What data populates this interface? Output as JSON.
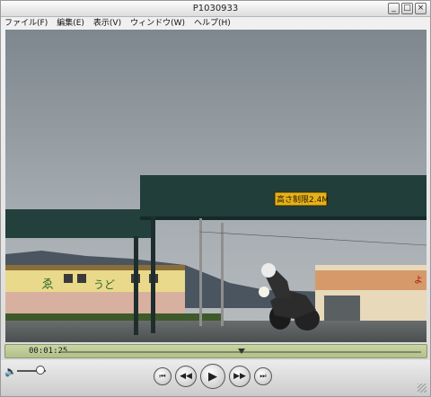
{
  "window": {
    "title": "P1030933",
    "minimize_glyph": "_",
    "maximize_glyph": "□",
    "close_glyph": "×"
  },
  "menu": {
    "items": [
      {
        "label": "ファイル(F)"
      },
      {
        "label": "編集(E)"
      },
      {
        "label": "表示(V)"
      },
      {
        "label": "ウィンドウ(W)"
      },
      {
        "label": "ヘルプ(H)"
      }
    ]
  },
  "video": {
    "sign_text": "高さ制限2.4M",
    "building_left_text": "ゑ",
    "building_left_text2": "うど",
    "building_right_text": "よ"
  },
  "controls": {
    "timecode": "00:01:25",
    "playback_progress": 0.5,
    "volume_level": 0.8,
    "icons": {
      "volume": "speaker-icon",
      "skip_back": "skip-back-icon",
      "rewind": "rewind-icon",
      "play": "play-icon",
      "fast_forward": "fast-forward-icon",
      "skip_forward": "skip-forward-icon"
    },
    "glyphs": {
      "volume": "🔈",
      "skip_back": "⏮",
      "rewind": "◀◀",
      "play": "▶",
      "fast_forward": "▶▶",
      "skip_forward": "⏭"
    }
  },
  "colors": {
    "control_bar": "#c9d5a3",
    "sky": "#8a9299",
    "canopy": "#24423f",
    "sign": "#e6b21a"
  }
}
